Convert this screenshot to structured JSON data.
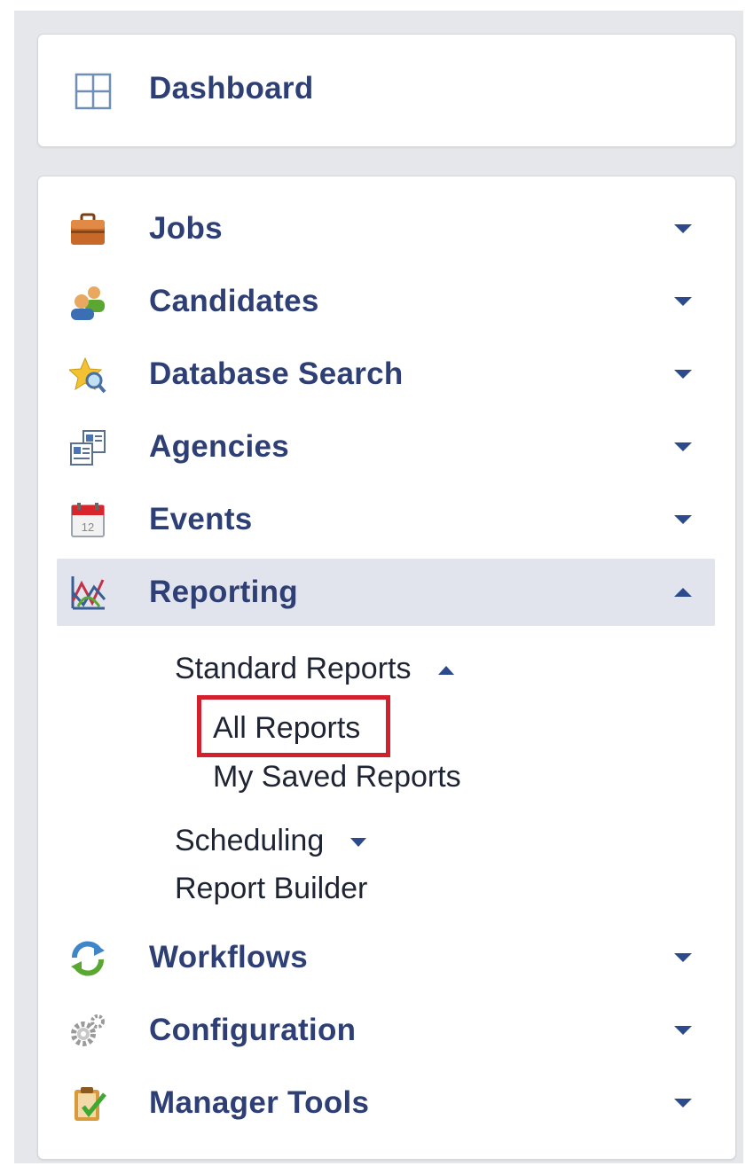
{
  "nav": {
    "dashboard": {
      "label": "Dashboard",
      "icon": "grid-icon"
    },
    "items": [
      {
        "name": "jobs",
        "label": "Jobs",
        "icon": "briefcase-icon",
        "expanded": false
      },
      {
        "name": "candidates",
        "label": "Candidates",
        "icon": "people-icon",
        "expanded": false
      },
      {
        "name": "database-search",
        "label": "Database Search",
        "icon": "star-search-icon",
        "expanded": false
      },
      {
        "name": "agencies",
        "label": "Agencies",
        "icon": "id-cards-icon",
        "expanded": false
      },
      {
        "name": "events",
        "label": "Events",
        "icon": "calendar-icon",
        "expanded": false
      },
      {
        "name": "reporting",
        "label": "Reporting",
        "icon": "chart-icon",
        "expanded": true
      },
      {
        "name": "workflows",
        "label": "Workflows",
        "icon": "refresh-icon",
        "expanded": false
      },
      {
        "name": "configuration",
        "label": "Configuration",
        "icon": "gear-icon",
        "expanded": false
      },
      {
        "name": "manager-tools",
        "label": "Manager Tools",
        "icon": "clipboard-icon",
        "expanded": false
      }
    ],
    "reporting_sub": {
      "standard_reports": "Standard Reports",
      "all_reports": "All Reports",
      "my_saved_reports": "My Saved Reports",
      "scheduling": "Scheduling",
      "report_builder": "Report Builder"
    }
  },
  "colors": {
    "label": "#2e3f75",
    "arrow": "#2d4a8c",
    "active_bg": "#e1e4ec",
    "highlight_border": "#d2212c"
  }
}
